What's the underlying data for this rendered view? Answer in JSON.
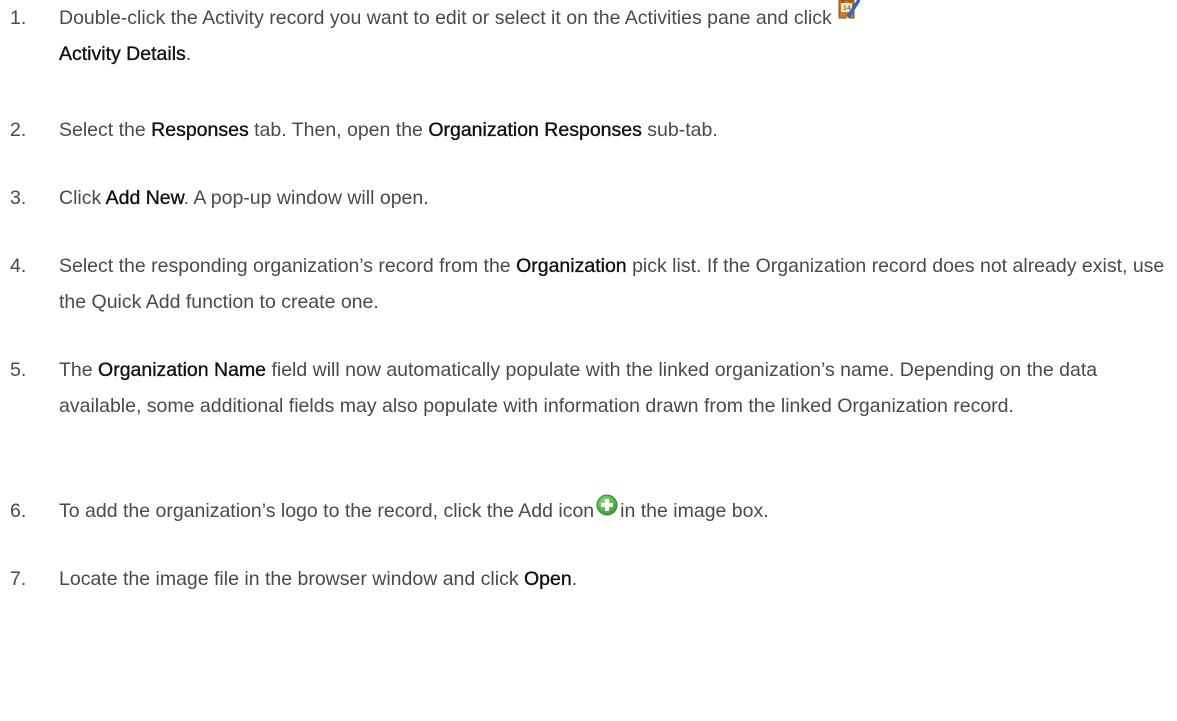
{
  "steps": [
    {
      "number": "1.",
      "text_a": "Double-click the Activity record you want to edit or select it on the Activities pane and click",
      "bold_a": "Activity Details",
      "text_b": "."
    },
    {
      "number": "2.",
      "text_a": "Select the ",
      "bold_a": "Responses",
      "text_b": " tab. Then, open the ",
      "bold_b": "Organization Responses",
      "text_c": " sub-tab."
    },
    {
      "number": "3.",
      "text_a": "Click ",
      "bold_a": "Add New",
      "text_b": ". A pop-up window will open."
    },
    {
      "number": "4.",
      "text_a": "Select the responding organization’s record from the ",
      "bold_a": "Organization",
      "text_b": " pick list. If the Organization record does not already exist, use the Quick Add function to create one."
    },
    {
      "number": "5.",
      "text_a": "The ",
      "bold_a": "Organization Name",
      "text_b": " field will now automatically populate with the linked organization’s name. Depending on the data available, some additional fields may also populate with information drawn from the linked Organization record."
    },
    {
      "number": "6.",
      "text_a": "To add the organization’s logo to the record, click the Add icon",
      "text_b": "in the image box."
    },
    {
      "number": "7.",
      "text_a": "Locate the image file in the browser window and click ",
      "bold_a": "Open",
      "text_b": "."
    }
  ],
  "icons": {
    "activity_details": "activity-details-icon",
    "add": "add-plus-icon"
  },
  "colors": {
    "body_text": "#4a4a4a",
    "bold_text": "#111111",
    "add_icon_green": "#4cb848"
  }
}
